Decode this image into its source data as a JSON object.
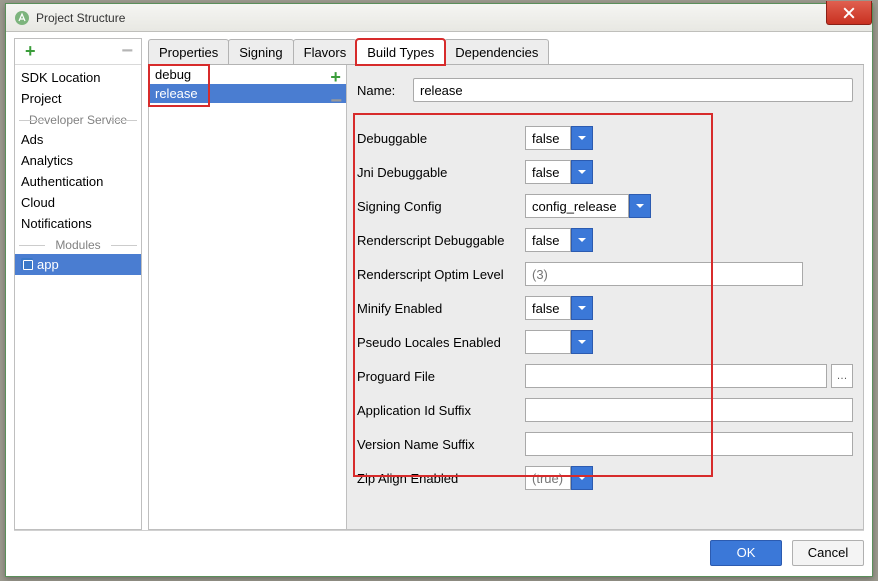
{
  "window": {
    "title": "Project Structure"
  },
  "sidebar": {
    "items": [
      {
        "label": "SDK Location"
      },
      {
        "label": "Project"
      }
    ],
    "dev_header": "Developer Service",
    "dev_items": [
      {
        "label": "Ads"
      },
      {
        "label": "Analytics"
      },
      {
        "label": "Authentication"
      },
      {
        "label": "Cloud"
      },
      {
        "label": "Notifications"
      }
    ],
    "mod_header": "Modules",
    "mod_items": [
      {
        "label": "app"
      }
    ]
  },
  "tabs": [
    {
      "label": "Properties"
    },
    {
      "label": "Signing"
    },
    {
      "label": "Flavors"
    },
    {
      "label": "Build Types"
    },
    {
      "label": "Dependencies"
    }
  ],
  "buildtypes": {
    "items": [
      {
        "label": "debug"
      },
      {
        "label": "release"
      }
    ]
  },
  "form": {
    "name_label": "Name:",
    "name_value": "release",
    "fields": {
      "debuggable": {
        "label": "Debuggable",
        "value": "false"
      },
      "jni_debuggable": {
        "label": "Jni Debuggable",
        "value": "false"
      },
      "signing_config": {
        "label": "Signing Config",
        "value": "config_release"
      },
      "renderscript_debuggable": {
        "label": "Renderscript Debuggable",
        "value": "false"
      },
      "renderscript_optim": {
        "label": "Renderscript Optim Level",
        "placeholder": "(3)"
      },
      "minify_enabled": {
        "label": "Minify Enabled",
        "value": "false"
      },
      "pseudo_locales": {
        "label": "Pseudo Locales Enabled",
        "value": ""
      },
      "proguard_file": {
        "label": "Proguard File",
        "value": ""
      },
      "app_id_suffix": {
        "label": "Application Id Suffix",
        "value": ""
      },
      "version_name_suffix": {
        "label": "Version Name Suffix",
        "value": ""
      },
      "zip_align": {
        "label": "Zip Align Enabled",
        "placeholder": "(true)"
      }
    }
  },
  "buttons": {
    "ok": "OK",
    "cancel": "Cancel"
  },
  "glyph": {
    "ellipsis": "…"
  }
}
